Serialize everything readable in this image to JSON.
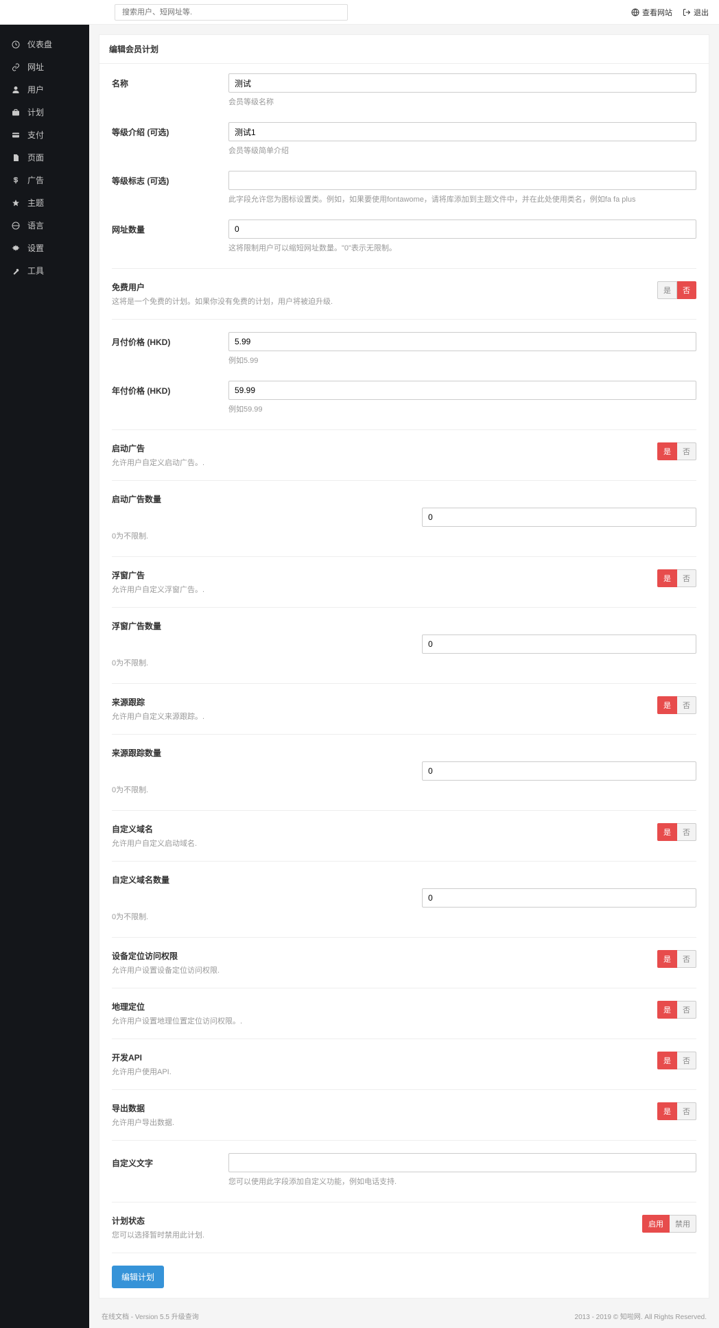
{
  "topbar": {
    "search_placeholder": "搜索用户、短网址等.",
    "view_site": "查看网站",
    "logout": "退出"
  },
  "sidebar": {
    "items": [
      {
        "label": "仪表盘"
      },
      {
        "label": "网址"
      },
      {
        "label": "用户"
      },
      {
        "label": "计划"
      },
      {
        "label": "支付"
      },
      {
        "label": "页面"
      },
      {
        "label": "广告"
      },
      {
        "label": "主题"
      },
      {
        "label": "语言"
      },
      {
        "label": "设置"
      },
      {
        "label": "工具"
      }
    ]
  },
  "page_title": "编辑会员计划",
  "fields": {
    "name": {
      "label": "名称",
      "value": "测试",
      "help": "会员等级名称"
    },
    "intro": {
      "label": "等级介绍 (可选)",
      "value": "测试1",
      "help": "会员等级简单介绍"
    },
    "icon": {
      "label": "等级标志 (可选)",
      "value": "",
      "help": "此字段允许您为图标设置类。例如，如果要使用fontawome，请将库添加到主题文件中，并在此处使用类名，例如fa fa plus"
    },
    "url_count": {
      "label": "网址数量",
      "value": "0",
      "help": "这将限制用户可以缩短网址数量。\"0\"表示无限制。"
    },
    "month_price": {
      "label": "月付价格 (HKD)",
      "value": "5.99",
      "help": "例如5.99"
    },
    "year_price": {
      "label": "年付价格 (HKD)",
      "value": "59.99",
      "help": "例如59.99"
    },
    "custom_text": {
      "label": "自定义文字",
      "value": "",
      "help": "您可以使用此字段添加自定义功能，例如电话支持."
    }
  },
  "toggles": {
    "free": {
      "label": "免费用户",
      "hint": "这将是一个免费的计划。如果你没有免费的计划，用户将被迫升级.",
      "yes": "是",
      "no": "否",
      "active": "no"
    },
    "splash_ad": {
      "label": "启动广告",
      "hint": "允许用户自定义启动广告。.",
      "yes": "是",
      "no": "否",
      "active": "yes"
    },
    "overlay_ad": {
      "label": "浮窗广告",
      "hint": "允许用户自定义浮窗广告。.",
      "yes": "是",
      "no": "否",
      "active": "yes"
    },
    "referrer": {
      "label": "来源跟踪",
      "hint": "允许用户自定义来源跟踪。.",
      "yes": "是",
      "no": "否",
      "active": "yes"
    },
    "custom_domain": {
      "label": "自定义域名",
      "hint": "允许用户自定义启动域名.",
      "yes": "是",
      "no": "否",
      "active": "yes"
    },
    "device": {
      "label": "设备定位访问权限",
      "hint": "允许用户设置设备定位访问权限.",
      "yes": "是",
      "no": "否",
      "active": "yes"
    },
    "geo": {
      "label": "地理定位",
      "hint": "允许用户设置地理位置定位访问权限。.",
      "yes": "是",
      "no": "否",
      "active": "yes"
    },
    "api": {
      "label": "开发API",
      "hint": "允许用户使用API.",
      "yes": "是",
      "no": "否",
      "active": "yes"
    },
    "export": {
      "label": "导出数据",
      "hint": "允许用户导出数据.",
      "yes": "是",
      "no": "否",
      "active": "yes"
    },
    "status": {
      "label": "计划状态",
      "hint": "您可以选择暂时禁用此计划.",
      "yes": "启用",
      "no": "禁用",
      "active": "yes"
    }
  },
  "numbers": {
    "splash_count": {
      "label": "启动广告数量",
      "hint": "0为不限制.",
      "value": "0"
    },
    "overlay_count": {
      "label": "浮窗广告数量",
      "hint": "0为不限制.",
      "value": "0"
    },
    "referrer_count": {
      "label": "来源跟踪数量",
      "hint": "0为不限制.",
      "value": "0"
    },
    "domain_count": {
      "label": "自定义域名数量",
      "hint": "0为不限制.",
      "value": "0"
    }
  },
  "submit_label": "编辑计划",
  "footer": {
    "left": "在线文档 - Version 5.5 升级查询",
    "right": "2013 - 2019 © 知啦网. All Rights Reserved."
  }
}
